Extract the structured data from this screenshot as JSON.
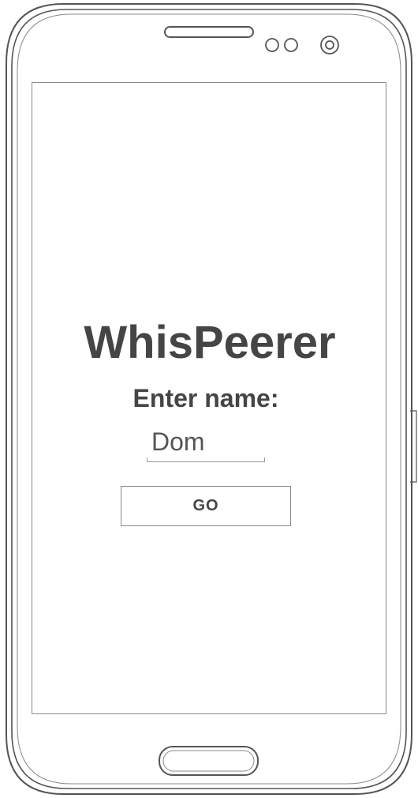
{
  "app": {
    "title": "WhisPeerer"
  },
  "form": {
    "prompt": "Enter name:",
    "name_value": "Dom",
    "go_label": "GO"
  },
  "device": {
    "frame_color": "#555555",
    "icons": [
      "speaker-icon",
      "sensor-icon",
      "front-camera-icon",
      "home-button"
    ]
  }
}
